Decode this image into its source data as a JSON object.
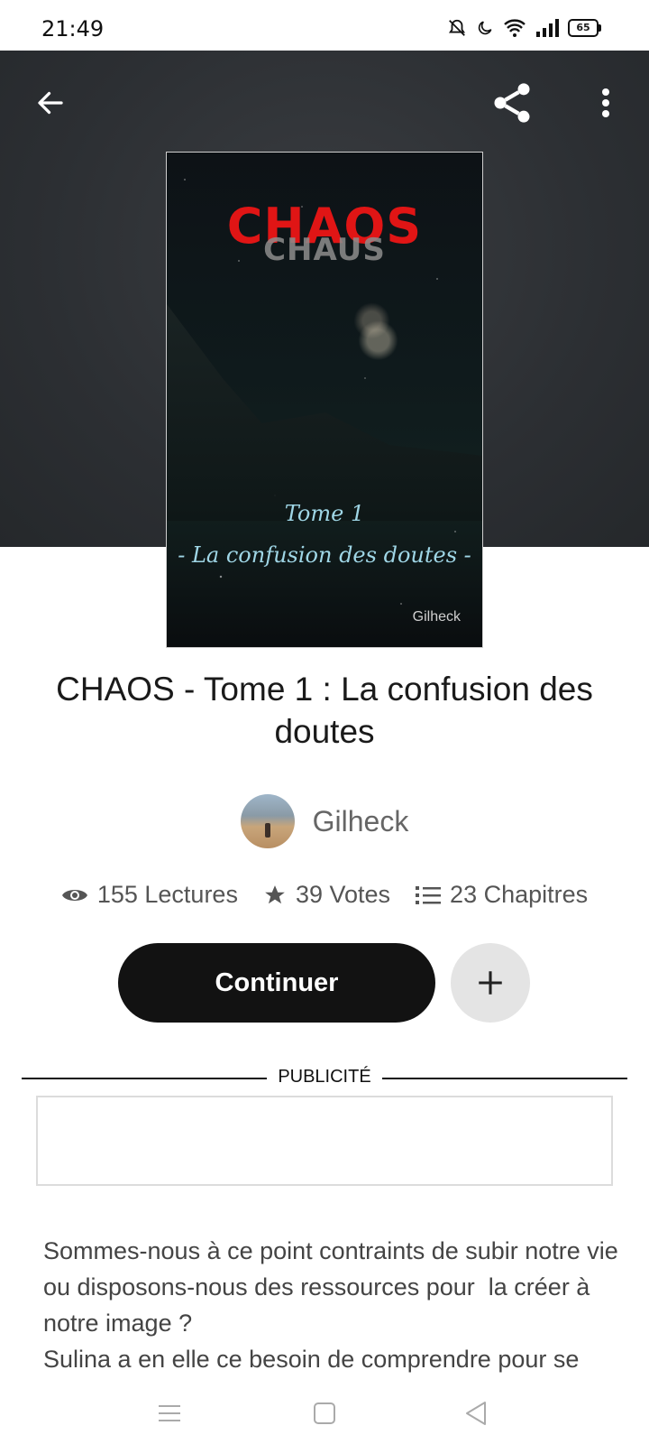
{
  "status_bar": {
    "time": "21:49",
    "battery": "65"
  },
  "book": {
    "title": "CHAOS - Tome 1 : La confusion des doutes",
    "cover": {
      "title": "CHAOS",
      "title_echo": "CHAUS",
      "tome": "Tome 1",
      "subtitle": "- La confusion des doutes -",
      "author": "Gilheck"
    },
    "author": "Gilheck",
    "stats": {
      "reads": "155 Lectures",
      "votes": "39 Votes",
      "chapters": "23 Chapitres"
    },
    "synopsis": "Sommes-nous à ce point contraints de subir notre vie ou disposons-nous des ressources pour  la créer à notre image ?\nSulina a en elle ce besoin de comprendre pour se"
  },
  "actions": {
    "continue_label": "Continuer"
  },
  "ad": {
    "label": "PUBLICITÉ"
  },
  "icons": {
    "back": "arrow-left-icon",
    "share": "share-icon",
    "more": "more-vertical-icon",
    "views": "eye-icon",
    "votes": "star-icon",
    "chapters": "list-icon",
    "add": "plus-icon"
  },
  "colors": {
    "cover_title": "#e01515",
    "cover_text": "#9fd6e6",
    "button_dark": "#121212",
    "header_bg": "#2c2f33"
  }
}
